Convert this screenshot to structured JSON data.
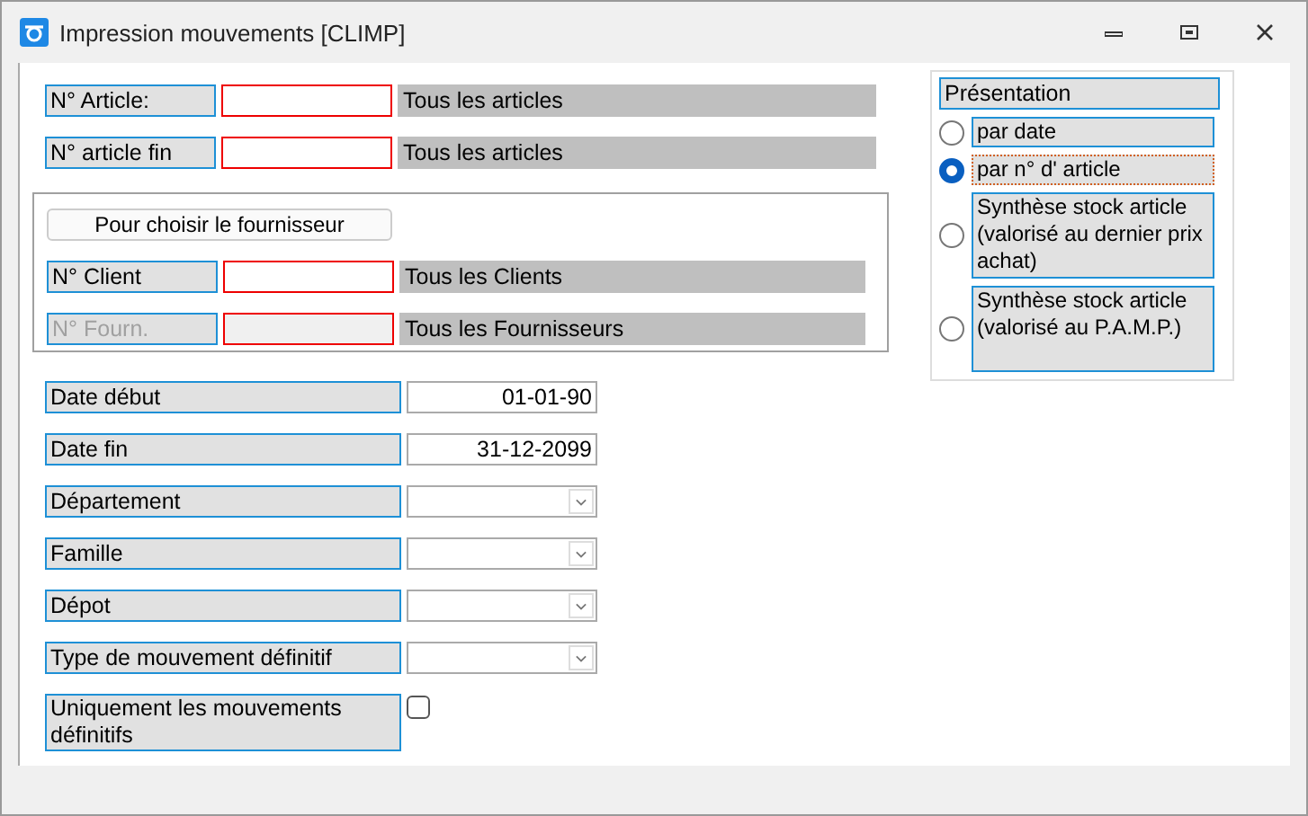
{
  "window": {
    "title": "Impression mouvements [CLIMP]"
  },
  "article_rows": [
    {
      "label": "N° Article:",
      "description": "Tous les articles",
      "disabled": false
    },
    {
      "label": "N° article fin",
      "description": "Tous les articles",
      "disabled": false
    }
  ],
  "supplier_group": {
    "button": "Pour choisir le fournisseur",
    "rows": [
      {
        "label": "N° Client",
        "description": "Tous les Clients",
        "disabled": false
      },
      {
        "label": "N° Fourn.",
        "description": "Tous les Fournisseurs",
        "disabled": true
      }
    ]
  },
  "presentation": {
    "title": "Présentation",
    "options": [
      {
        "label": "par date",
        "selected": false
      },
      {
        "label": "par n° d' article",
        "selected": true
      },
      {
        "label": "Synthèse stock article (valorisé au dernier prix achat)",
        "selected": false
      },
      {
        "label": "Synthèse stock article (valorisé au P.A.M.P.)",
        "selected": false
      }
    ]
  },
  "filters": [
    {
      "kind": "text",
      "label": "Date début",
      "value": "01-01-90"
    },
    {
      "kind": "text",
      "label": "Date fin",
      "value": "31-12-2099"
    },
    {
      "kind": "dropdown",
      "label": "Département"
    },
    {
      "kind": "dropdown",
      "label": "Famille"
    },
    {
      "kind": "dropdown",
      "label": "Dépot"
    },
    {
      "kind": "dropdown",
      "label": "Type de mouvement définitif"
    },
    {
      "kind": "checkbox",
      "label": "Uniquement les mouvements définitifs",
      "checked": false
    }
  ]
}
